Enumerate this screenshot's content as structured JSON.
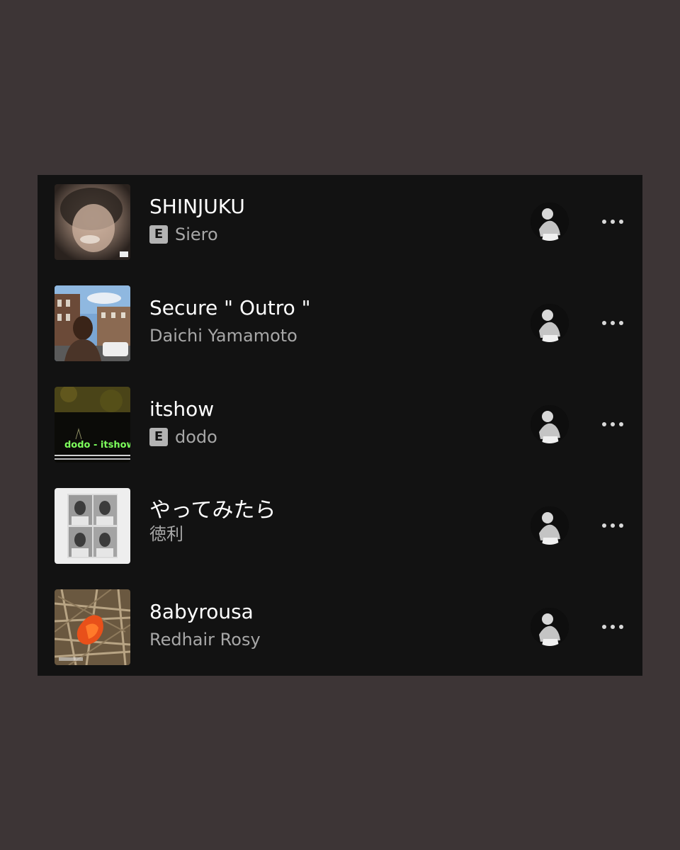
{
  "tracks": [
    {
      "title": "SHINJUKU",
      "artist": "Siero",
      "explicit": true,
      "explicit_label": "E"
    },
    {
      "title": "Secure \" Outro \"",
      "artist": "Daichi Yamamoto",
      "explicit": false
    },
    {
      "title": "itshow",
      "artist": "dodo",
      "explicit": true,
      "explicit_label": "E",
      "cover_text": "dodo - itshow"
    },
    {
      "title": "やってみたら",
      "artist": "徳利",
      "explicit": false
    },
    {
      "title": "8abyrousa",
      "artist": "Redhair Rosy",
      "explicit": false
    }
  ],
  "icons": {
    "more": "more-options-icon",
    "avatar": "user-avatar"
  },
  "colors": {
    "background": "#3d3536",
    "panel": "#121212",
    "title": "#ffffff",
    "artist": "#a7a7a7"
  }
}
